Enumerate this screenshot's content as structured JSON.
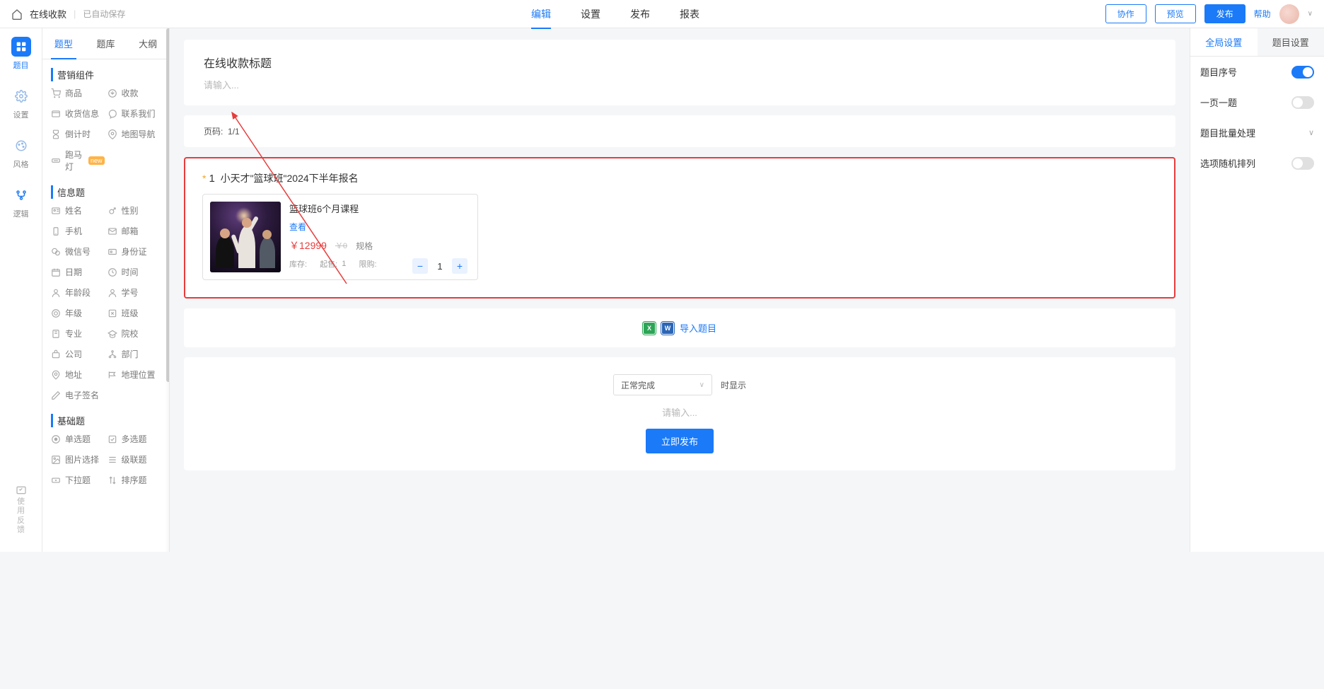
{
  "header": {
    "app_title": "在线收款",
    "save_status": "已自动保存",
    "tabs": [
      {
        "label": "编辑",
        "active": true
      },
      {
        "label": "设置",
        "active": false
      },
      {
        "label": "发布",
        "active": false
      },
      {
        "label": "报表",
        "active": false
      }
    ],
    "collab_btn": "协作",
    "preview_btn": "预览",
    "publish_btn": "发布",
    "help": "帮助"
  },
  "vert_nav": [
    {
      "label": "题目",
      "active": true
    },
    {
      "label": "设置",
      "active": false
    },
    {
      "label": "风格",
      "active": false
    },
    {
      "label": "逻辑",
      "active": false
    }
  ],
  "feedback_label": "使用反馈",
  "comp_tabs": [
    {
      "label": "题型",
      "active": true
    },
    {
      "label": "题库",
      "active": false
    },
    {
      "label": "大纲",
      "active": false
    }
  ],
  "sections": {
    "marketing": {
      "title": "营销组件",
      "items": [
        "商品",
        "收款",
        "收货信息",
        "联系我们",
        "倒计时",
        "地图导航",
        "跑马灯"
      ]
    },
    "info": {
      "title": "信息题",
      "items": [
        "姓名",
        "性别",
        "手机",
        "邮箱",
        "微信号",
        "身份证",
        "日期",
        "时间",
        "年龄段",
        "学号",
        "年级",
        "班级",
        "专业",
        "院校",
        "公司",
        "部门",
        "地址",
        "地理位置",
        "电子签名"
      ]
    },
    "basic": {
      "title": "基础题",
      "items": [
        "单选题",
        "多选题",
        "图片选择",
        "级联题",
        "下拉题",
        "排序题"
      ]
    }
  },
  "form": {
    "title": "在线收款标题",
    "placeholder": "请输入...",
    "page_code_label": "页码:",
    "page_code": "1/1"
  },
  "question": {
    "number": "1",
    "title": "小天才\"篮球班\"2024下半年报名",
    "product": {
      "name": "篮球班6个月课程",
      "view": "查看",
      "price": "￥12999",
      "old_price": "￥0",
      "spec": "规格",
      "stock_label": "库存:",
      "sell_label": "起售:",
      "sell_val": "1",
      "limit_label": "限购:",
      "qty": "1"
    }
  },
  "import_label": "导入题目",
  "bottom": {
    "select_value": "正常完成",
    "display_label": "时显示",
    "desc_placeholder": "请输入...",
    "publish_now": "立即发布"
  },
  "settings": {
    "tabs": [
      {
        "label": "全局设置",
        "active": true
      },
      {
        "label": "题目设置",
        "active": false
      }
    ],
    "rows": {
      "serial": {
        "label": "题目序号",
        "on": true
      },
      "one_page": {
        "label": "一页一题",
        "on": false
      },
      "batch": {
        "label": "题目批量处理"
      },
      "random": {
        "label": "选项随机排列",
        "on": false
      }
    }
  }
}
